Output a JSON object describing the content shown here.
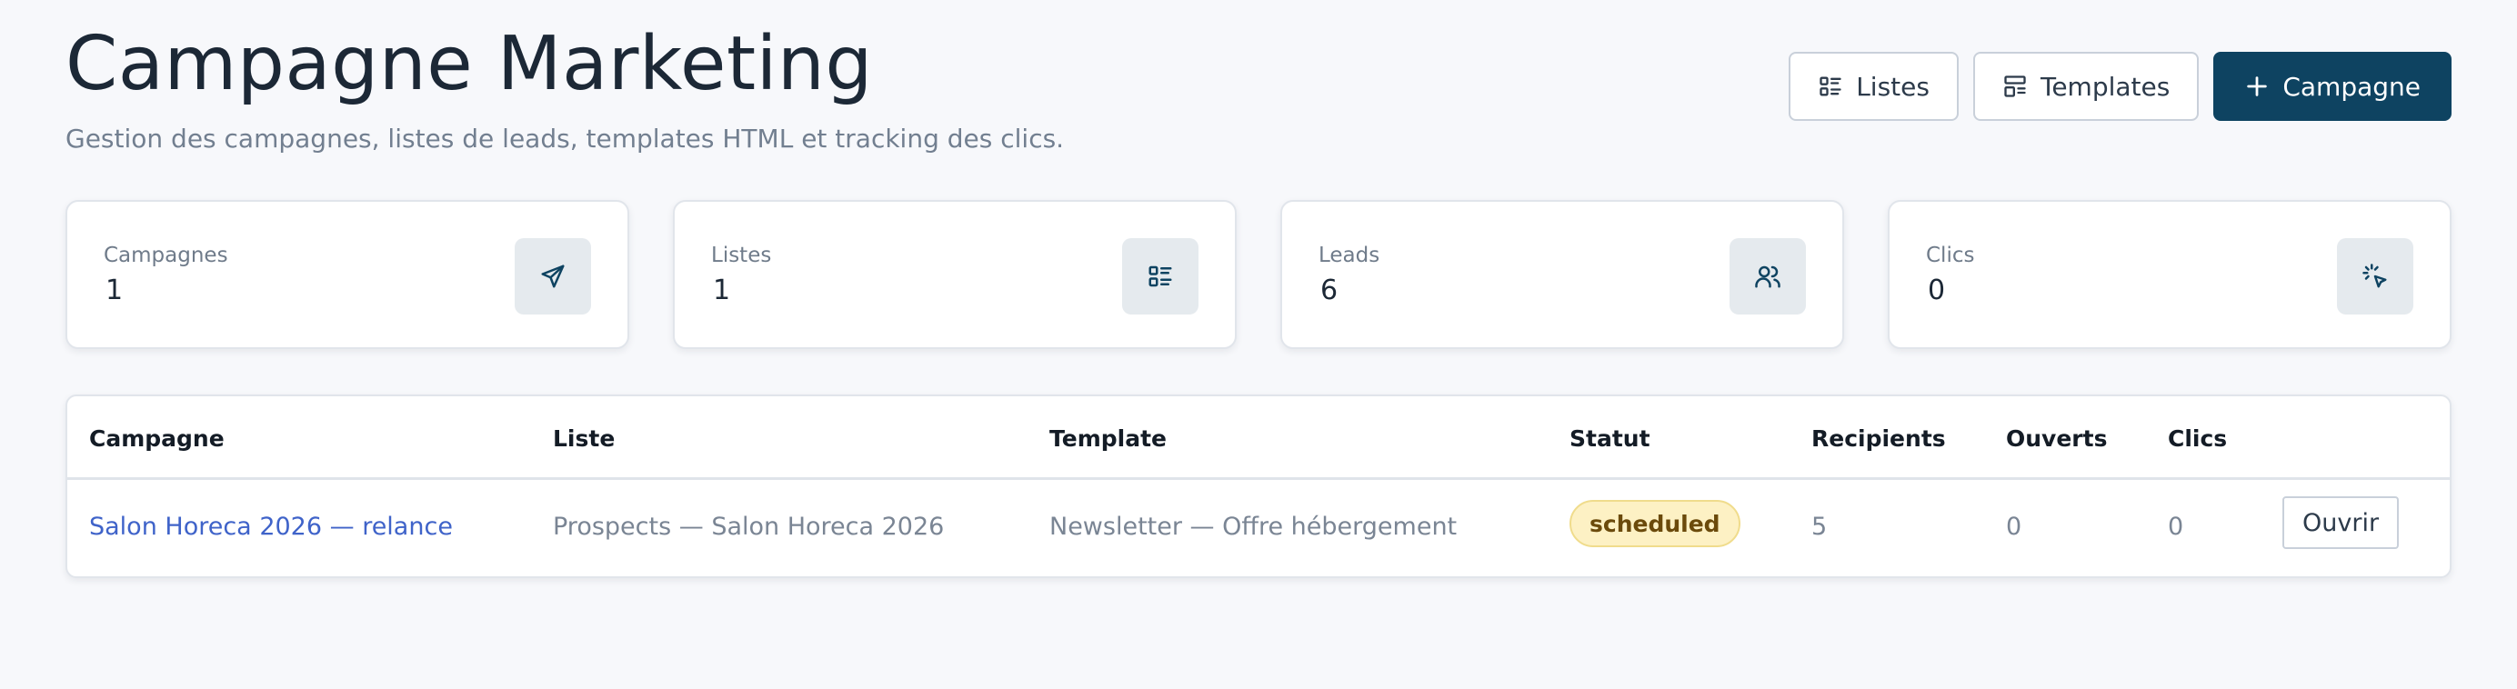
{
  "header": {
    "title": "Campagne Marketing",
    "subtitle": "Gestion des campagnes, listes de leads, templates HTML et tracking des clics."
  },
  "actions": {
    "lists_label": "Listes",
    "templates_label": "Templates",
    "new_campaign_label": "Campagne",
    "lists_icon": "list-icon",
    "templates_icon": "layout-template-icon",
    "new_campaign_icon": "plus-icon"
  },
  "stats": [
    {
      "label": "Campagnes",
      "value": "1",
      "icon": "send-icon"
    },
    {
      "label": "Listes",
      "value": "1",
      "icon": "list-icon"
    },
    {
      "label": "Leads",
      "value": "6",
      "icon": "users-icon"
    },
    {
      "label": "Clics",
      "value": "0",
      "icon": "click-icon"
    }
  ],
  "table": {
    "columns": [
      "Campagne",
      "Liste",
      "Template",
      "Statut",
      "Recipients",
      "Ouverts",
      "Clics"
    ],
    "rows": [
      {
        "campaign": "Salon Horeca 2026 — relance",
        "list": "Prospects — Salon Horeca 2026",
        "template": "Newsletter — Offre hébergement",
        "status": "scheduled",
        "recipients": "5",
        "opened": "0",
        "clicks": "0",
        "action": "Ouvrir"
      }
    ]
  },
  "colors": {
    "primary": "#0e4361",
    "background": "#f7f8fb",
    "link": "#3f63c9",
    "badge_bg": "#fdf1c4",
    "badge_text": "#6b4a0b"
  }
}
